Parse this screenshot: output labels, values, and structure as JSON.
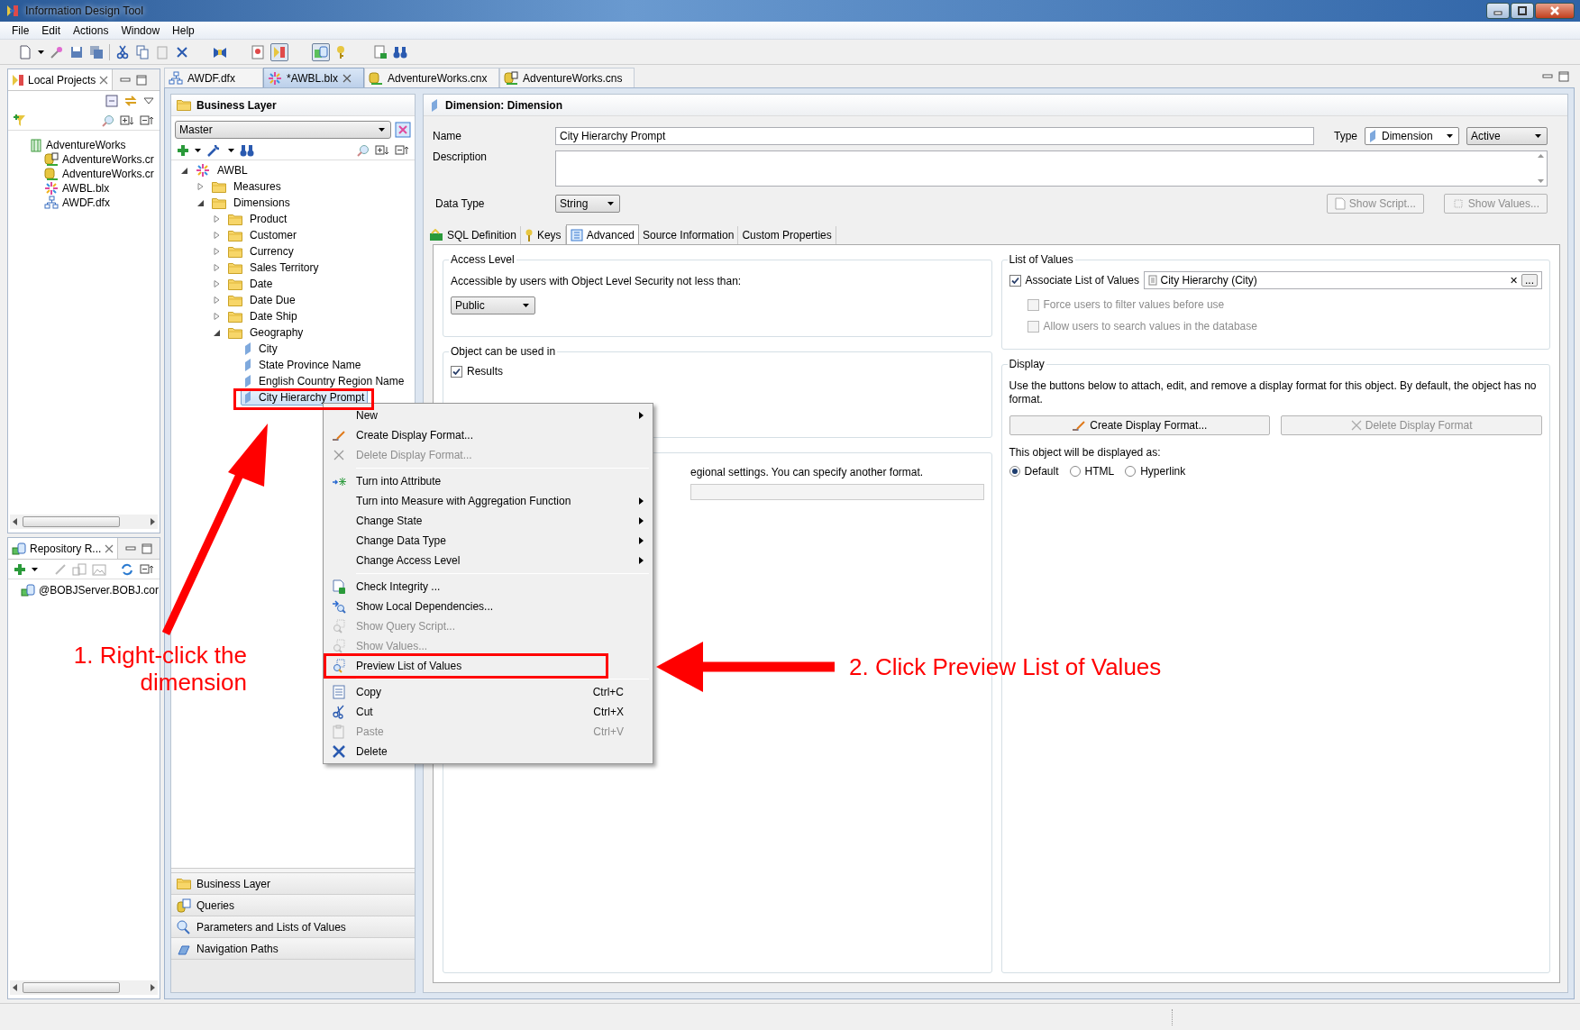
{
  "window": {
    "title": "Information Design Tool"
  },
  "menu": [
    "File",
    "Edit",
    "Actions",
    "Window",
    "Help"
  ],
  "local_projects": {
    "title": "Local Projects",
    "tree": [
      {
        "label": "AdventureWorks",
        "kind": "project",
        "children": [
          {
            "label": "AdventureWorks.cr",
            "kind": "connection_shortcut"
          },
          {
            "label": "AdventureWorks.cr",
            "kind": "connection"
          },
          {
            "label": "AWBL.blx",
            "kind": "business_layer"
          },
          {
            "label": "AWDF.dfx",
            "kind": "foundation"
          }
        ]
      }
    ]
  },
  "repository": {
    "title": "Repository R...",
    "items": [
      {
        "label": "@BOBJServer.BOBJ.cor",
        "kind": "session"
      }
    ]
  },
  "editor_tabs": [
    {
      "label": "AWDF.dfx",
      "kind": "foundation",
      "selected": false
    },
    {
      "label": "*AWBL.blx",
      "kind": "business_layer",
      "selected": true
    },
    {
      "label": "AdventureWorks.cnx",
      "kind": "connection",
      "selected": false
    },
    {
      "label": "AdventureWorks.cns",
      "kind": "connection_shortcut",
      "selected": false
    }
  ],
  "business_layer": {
    "title": "Business Layer",
    "view": "Master",
    "tree": [
      {
        "label": "AWBL",
        "kind": "business_layer",
        "expanded": true,
        "selected": false,
        "children": [
          {
            "label": "Measures",
            "kind": "folder",
            "expanded": false,
            "selected": false
          },
          {
            "label": "Dimensions",
            "kind": "folder",
            "expanded": true,
            "selected": false,
            "children": [
              {
                "label": "Product",
                "kind": "folder",
                "expanded": false,
                "selected": false
              },
              {
                "label": "Customer",
                "kind": "folder",
                "expanded": false,
                "selected": false
              },
              {
                "label": "Currency",
                "kind": "folder",
                "expanded": false,
                "selected": false
              },
              {
                "label": "Sales Territory",
                "kind": "folder",
                "expanded": false,
                "selected": false
              },
              {
                "label": "Date",
                "kind": "folder",
                "expanded": false,
                "selected": false
              },
              {
                "label": "Date Due",
                "kind": "folder",
                "expanded": false,
                "selected": false
              },
              {
                "label": "Date Ship",
                "kind": "folder",
                "expanded": false,
                "selected": false
              },
              {
                "label": "Geography",
                "kind": "folder",
                "expanded": true,
                "selected": false,
                "children": [
                  {
                    "label": "City",
                    "kind": "dimension",
                    "selected": false
                  },
                  {
                    "label": "State Province Name",
                    "kind": "dimension",
                    "selected": false
                  },
                  {
                    "label": "English Country Region Name",
                    "kind": "dimension",
                    "selected": false
                  },
                  {
                    "label": "City Hierarchy Prompt",
                    "kind": "dimension",
                    "selected": true
                  }
                ]
              }
            ]
          }
        ]
      }
    ],
    "navigator": [
      {
        "label": "Business Layer",
        "kind": "folder"
      },
      {
        "label": "Queries",
        "kind": "queries"
      },
      {
        "label": "Parameters and Lists of Values",
        "kind": "parameters"
      },
      {
        "label": "Navigation Paths",
        "kind": "paths"
      }
    ]
  },
  "details": {
    "header": "Dimension: Dimension",
    "name_label": "Name",
    "name": "City Hierarchy Prompt",
    "type_label": "Type",
    "type": "Dimension",
    "state": "Active",
    "description_label": "Description",
    "data_type_label": "Data Type",
    "data_type": "String",
    "buttons": [
      {
        "label": "Show Script...",
        "kind": "script",
        "disabled": true
      },
      {
        "label": "Show Values...",
        "kind": "values",
        "disabled": true
      }
    ],
    "tabs": [
      {
        "label": "SQL Definition",
        "kind": "sql",
        "selected": false
      },
      {
        "label": "Keys",
        "kind": "keys",
        "selected": false
      },
      {
        "label": "Advanced",
        "kind": "advanced",
        "selected": true
      },
      {
        "label": "Source Information",
        "kind": "plain",
        "selected": false
      },
      {
        "label": "Custom Properties",
        "kind": "plain",
        "selected": false
      }
    ],
    "access_level": {
      "title": "Access Level",
      "text": "Accessible by users with Object Level Security not less than:",
      "value": "Public"
    },
    "usage": {
      "title": "Object can be used in",
      "options": [
        {
          "label": "Results",
          "checked": true
        }
      ]
    },
    "format_note": "egional settings. You can specify another format.",
    "list_of_values": {
      "title": "List of Values",
      "options": [
        {
          "label": "Associate List of Values",
          "checked": true,
          "disabled": false
        },
        {
          "label": "Force users to filter values before use",
          "checked": false,
          "disabled": true
        },
        {
          "label": "Allow users to search values in the database",
          "checked": false,
          "disabled": true
        }
      ],
      "value": "City Hierarchy (City)",
      "clear": "✕",
      "browse": "..."
    },
    "display": {
      "title": "Display",
      "text": "Use the buttons below to attach, edit, and remove a display format for this object. By default, the object has no format.",
      "buttons": [
        {
          "label": "Create Display Format...",
          "kind": "create",
          "disabled": false
        },
        {
          "label": "Delete Display Format",
          "kind": "delete",
          "disabled": true
        }
      ],
      "shown_as": "This object will be displayed as:",
      "options": [
        {
          "label": "Default",
          "selected": true
        },
        {
          "label": "HTML",
          "selected": false
        },
        {
          "label": "Hyperlink",
          "selected": false
        }
      ]
    }
  },
  "context_menu": [
    {
      "label": "New",
      "kind": "plain",
      "submenu": true,
      "disabled": false
    },
    {
      "label": "Create Display Format...",
      "kind": "create",
      "submenu": false,
      "disabled": false
    },
    {
      "label": "Delete Display Format...",
      "kind": "delete_format",
      "submenu": false,
      "disabled": true
    },
    {
      "kind": "separator"
    },
    {
      "label": "Turn into Attribute",
      "kind": "convert",
      "submenu": false,
      "disabled": false
    },
    {
      "label": "Turn into Measure with Aggregation Function",
      "kind": "plain",
      "submenu": true,
      "disabled": false
    },
    {
      "label": "Change State",
      "kind": "plain",
      "submenu": true,
      "disabled": false
    },
    {
      "label": "Change Data Type",
      "kind": "plain",
      "submenu": true,
      "disabled": false
    },
    {
      "label": "Change Access Level",
      "kind": "plain",
      "submenu": true,
      "disabled": false
    },
    {
      "kind": "separator"
    },
    {
      "label": "Check Integrity ...",
      "kind": "check",
      "submenu": false,
      "disabled": false
    },
    {
      "label": "Show Local Dependencies...",
      "kind": "dependencies",
      "submenu": false,
      "disabled": false
    },
    {
      "label": "Show Query Script...",
      "kind": "values",
      "submenu": false,
      "disabled": true
    },
    {
      "label": "Show Values...",
      "kind": "values",
      "submenu": false,
      "disabled": true
    },
    {
      "label": "Preview List of Values",
      "kind": "values",
      "submenu": false,
      "disabled": false,
      "highlighted": true
    },
    {
      "kind": "separator"
    },
    {
      "label": "Copy",
      "kind": "copy",
      "shortcut": "Ctrl+C",
      "submenu": false,
      "disabled": false
    },
    {
      "label": "Cut",
      "kind": "cut",
      "shortcut": "Ctrl+X",
      "submenu": false,
      "disabled": false
    },
    {
      "label": "Paste",
      "kind": "paste",
      "shortcut": "Ctrl+V",
      "submenu": false,
      "disabled": true
    },
    {
      "label": "Delete",
      "kind": "delete",
      "submenu": false,
      "disabled": false
    }
  ],
  "annotations": [
    {
      "text": "1. Right-click the\ndimension"
    },
    {
      "text": "2. Click Preview List of Values"
    }
  ]
}
